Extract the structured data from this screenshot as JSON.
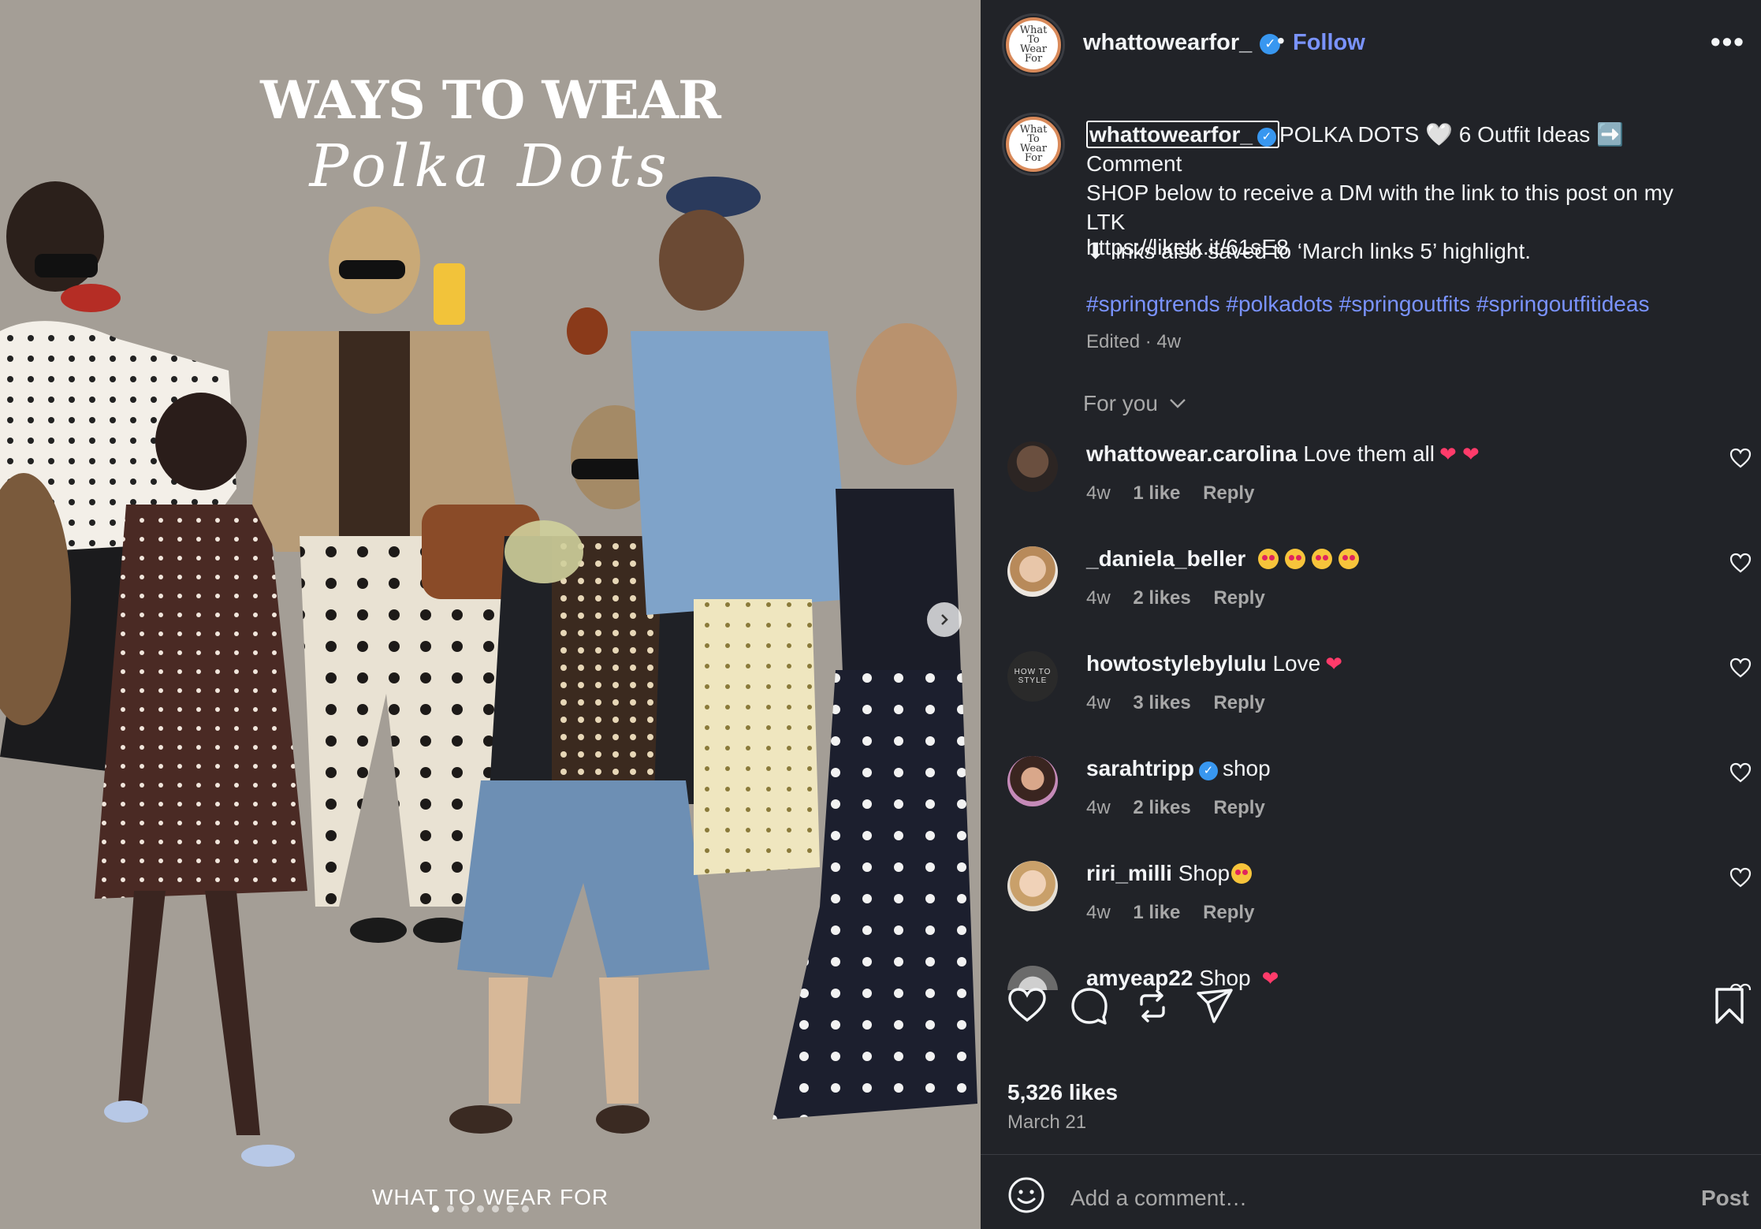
{
  "media": {
    "title": "WAYS TO WEAR",
    "script_title": "Polka Dots",
    "watermark": "WHAT TO WEAR FOR",
    "slide_count": 7,
    "active_slide": 1
  },
  "header": {
    "username": "whattowearfor_",
    "follow_label": "Follow",
    "dot": "•",
    "more_label": "•••",
    "avatar_text": "What To Wear For"
  },
  "caption": {
    "username": "whattowearfor_",
    "text_1": "POLKA DOTS 🤍 6 Outfit Ideas ➡️ Comment",
    "text_2": "SHOP below to receive a DM with the link to this post on my LTK",
    "text_3": "⬇ links also saved to ‘March links 5’ highlight.",
    "link": "https://liketk.it/61sE8",
    "hashtags": "#springtrends #polkadots #springoutfits #springoutfitideas",
    "edited": "Edited · 4w"
  },
  "for_you": "For you",
  "comments": [
    {
      "user": "whattowear.carolina",
      "text": "Love them all",
      "emojis": "❤ ❤",
      "age": "4w",
      "likes": "1 like",
      "reply": "Reply",
      "verified": false
    },
    {
      "user": "_daniela_beller",
      "text": "",
      "emojis": "",
      "age": "4w",
      "likes": "2 likes",
      "reply": "Reply",
      "verified": false
    },
    {
      "user": "howtostylebylulu",
      "text": "Love",
      "emojis": "❤",
      "age": "4w",
      "likes": "3 likes",
      "reply": "Reply",
      "verified": false,
      "avatar_text": "HOW TO STYLE"
    },
    {
      "user": "sarahtripp",
      "text": "shop",
      "emojis": "",
      "age": "4w",
      "likes": "2 likes",
      "reply": "Reply",
      "verified": true
    },
    {
      "user": "riri_milli",
      "text": "Shop",
      "emojis": "",
      "age": "4w",
      "likes": "1 like",
      "reply": "Reply",
      "verified": false
    },
    {
      "user": "amyeap22",
      "text": "Shop",
      "emojis": "❤",
      "age": "",
      "likes": "",
      "reply": "",
      "verified": false
    }
  ],
  "footer": {
    "likes": "5,326 likes",
    "date": "March 21",
    "add_comment_placeholder": "Add a comment…",
    "post_label": "Post"
  },
  "colors": {
    "panel_bg": "#212328",
    "accent_link": "#7a93ff",
    "verified": "#3897f0",
    "media_bg": "#a49e96"
  }
}
